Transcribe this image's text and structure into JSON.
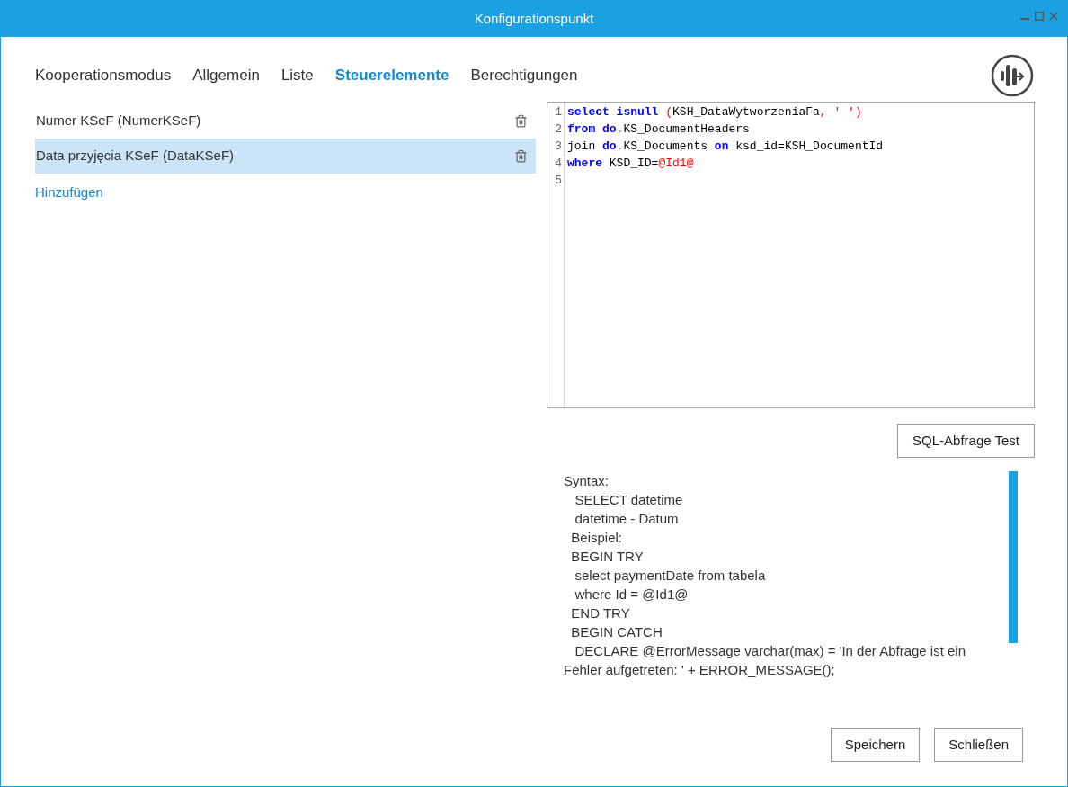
{
  "window": {
    "title": "Konfigurationspunkt"
  },
  "tabs": [
    {
      "label": "Kooperationsmodus",
      "selected": false
    },
    {
      "label": "Allgemein",
      "selected": false
    },
    {
      "label": "Liste",
      "selected": false
    },
    {
      "label": "Steuerelemente",
      "selected": true
    },
    {
      "label": "Berechtigungen",
      "selected": false
    }
  ],
  "controls": [
    {
      "label": "Numer KSeF (NumerKSeF)",
      "selected": false
    },
    {
      "label": "Data przyjęcia KSeF (DataKSeF)",
      "selected": true
    }
  ],
  "add_link": "Hinzufügen",
  "editor": {
    "lines": [
      {
        "number": "1",
        "tokens": [
          {
            "text": "select",
            "kind": "keyword"
          },
          {
            "text": " isnull",
            "kind": "keyword"
          },
          {
            "text": " (",
            "kind": "operator"
          },
          {
            "text": "KSH_DataWytworzeniaFa",
            "kind": "plain"
          },
          {
            "text": ",",
            "kind": "operator"
          },
          {
            "text": " ' '",
            "kind": "string"
          },
          {
            "text": ")",
            "kind": "operator"
          }
        ]
      },
      {
        "number": "2",
        "tokens": [
          {
            "text": "from",
            "kind": "keyword"
          },
          {
            "text": " do",
            "kind": "keyword"
          },
          {
            "text": ".",
            "kind": "punct"
          },
          {
            "text": "KS_DocumentHeaders",
            "kind": "plain"
          }
        ]
      },
      {
        "number": "3",
        "tokens": [
          {
            "text": "join ",
            "kind": "plain"
          },
          {
            "text": "do",
            "kind": "keyword"
          },
          {
            "text": ".",
            "kind": "punct"
          },
          {
            "text": "KS_Documents ",
            "kind": "plain"
          },
          {
            "text": "on",
            "kind": "keyword"
          },
          {
            "text": " ksd_id=KSH_DocumentId",
            "kind": "plain"
          }
        ]
      },
      {
        "number": "4",
        "tokens": [
          {
            "text": "where",
            "kind": "keyword"
          },
          {
            "text": " KSD_ID=",
            "kind": "plain"
          },
          {
            "text": "@Id1@",
            "kind": "string"
          }
        ]
      },
      {
        "number": "5"
      }
    ]
  },
  "test_button": "SQL-Abfrage Test",
  "help_text": [
    "Syntax:",
    "   SELECT datetime",
    "   datetime - Datum",
    "  Beispiel:",
    "  BEGIN TRY",
    "   select paymentDate from tabela",
    "   where Id = @Id1@",
    "  END TRY",
    "  BEGIN CATCH",
    "   DECLARE @ErrorMessage varchar(max) = 'In der Abfrage ist ein Fehler aufgetreten: ' + ERROR_MESSAGE();"
  ],
  "buttons": [
    "Speichern",
    "Schließen"
  ]
}
